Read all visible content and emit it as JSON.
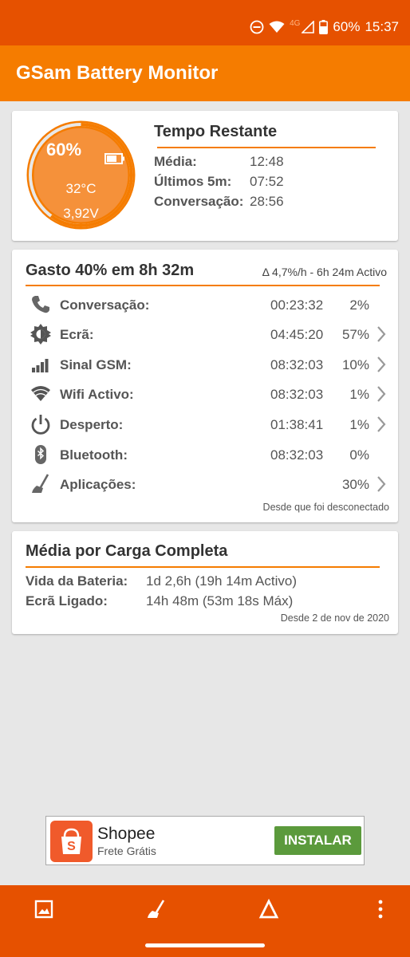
{
  "status": {
    "battery": "60%",
    "time": "15:37",
    "network": "4G"
  },
  "app": {
    "title": "GSam Battery Monitor"
  },
  "gauge": {
    "percent": "60%",
    "temperature": "32°C",
    "voltage": "3,92V",
    "level": 0.6
  },
  "time_remaining": {
    "title": "Tempo Restante",
    "rows": [
      {
        "label": "Média:",
        "value": "12:48"
      },
      {
        "label": "Últimos 5m:",
        "value": "07:52"
      },
      {
        "label": "Conversação:",
        "value": "28:56"
      }
    ]
  },
  "usage": {
    "title": "Gasto 40% em 8h 32m",
    "subtitle": "Δ 4,7%/h - 6h 24m Activo",
    "rows": [
      {
        "label": "Conversação:",
        "time": "00:23:32",
        "percent": "2%",
        "icon": "phone-icon"
      },
      {
        "label": "Ecrã:",
        "time": "04:45:20",
        "percent": "57%",
        "icon": "brightness-icon"
      },
      {
        "label": "Sinal GSM:",
        "time": "08:32:03",
        "percent": "10%",
        "icon": "signal-icon"
      },
      {
        "label": "Wifi Activo:",
        "time": "08:32:03",
        "percent": "1%",
        "icon": "wifi-icon"
      },
      {
        "label": "Desperto:",
        "time": "01:38:41",
        "percent": "1%",
        "icon": "power-icon"
      },
      {
        "label": "Bluetooth:",
        "time": "08:32:03",
        "percent": "0%",
        "icon": "bluetooth-icon"
      },
      {
        "label": "Aplicações:",
        "time": "",
        "percent": "30%",
        "icon": "broom-icon"
      }
    ],
    "footnote": "Desde que foi desconectado"
  },
  "full_charge": {
    "title": "Média por Carga Completa",
    "rows": [
      {
        "label": "Vida da Bateria:",
        "value": "1d 2,6h (19h 14m Activo)"
      },
      {
        "label": "Ecrã Ligado:",
        "value": "14h 48m (53m 18s Máx)"
      }
    ],
    "footnote": "Desde 2 de nov de 2020"
  },
  "ad": {
    "name": "Shopee",
    "subtitle": "Frete Grátis",
    "button": "INSTALAR"
  },
  "colors": {
    "accent": "#f57c00",
    "status_bar": "#e65100",
    "install_green": "#5b9a3c"
  }
}
